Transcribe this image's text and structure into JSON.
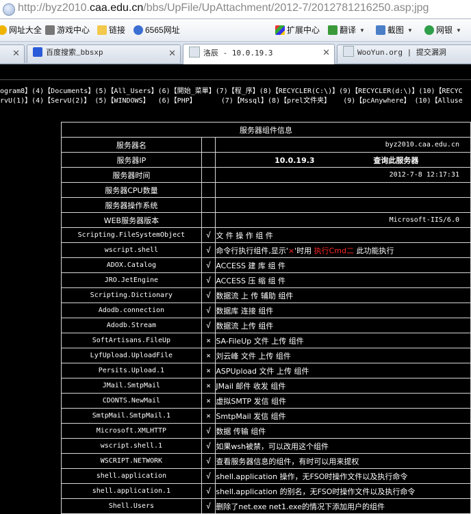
{
  "address_bar": {
    "url_prefix": "http://byz2010.",
    "url_domain": "caa.edu.cn",
    "url_path": "/bbs/UpFile/UpAttachment/2012-7/2012781216250.asp;jpg"
  },
  "toolbar": {
    "left": [
      "网址大全",
      "游戏中心",
      "链接",
      "6565网址"
    ],
    "right": [
      "扩展中心",
      "翻译",
      "截图",
      "网银"
    ]
  },
  "tabs": [
    {
      "label": "百度搜索_bbsxp"
    },
    {
      "label": "洛辰 - 10.0.19.3"
    },
    {
      "label": "WooYun.org | 提交漏洞"
    }
  ],
  "links": {
    "line1": "ogram8】(4)【Documents】(5)【All_Users】(6)【開始_菜單】(7)【程_序】(8)【RECYCLER(C:\\)】(9)【RECYCLER(d:\\)】(10)【RECYC",
    "line2": "rvU(1)】(4)【ServU(2)】 (5)【WINDOWS】  (6)【PHP】      (7)【Mssql】(8)【prel文件夹】   (9)【pcAnywhere】 (10)【Alluse"
  },
  "table": {
    "title": "服务器组件信息",
    "server_rows": [
      {
        "name": "服务器名",
        "value": "byz2010.caa.edu.cn"
      },
      {
        "name": "服务器IP",
        "value": "10.0.19.3",
        "extra": "查询此服务器"
      },
      {
        "name": "服务器时间",
        "value": "2012-7-8 12:17:31"
      },
      {
        "name": "服务器CPU数量",
        "value": ""
      },
      {
        "name": "服务器操作系统",
        "value": ""
      },
      {
        "name": "WEB服务器版本",
        "value": "Microsoft-IIS/6.0"
      }
    ],
    "components": [
      {
        "name": "Scripting.FileSystemObject",
        "mark": "√",
        "desc": "文 件 操 作 组 件"
      },
      {
        "name": "wscript.shell",
        "mark": "√",
        "desc_a": "命令行执行组件,显示'",
        "desc_x": "×",
        "desc_b": "'时用 ",
        "desc_red": "执行Cmd二",
        "desc_c": " 此功能执行"
      },
      {
        "name": "ADOX.Catalog",
        "mark": "√",
        "desc": "ACCESS 建 库 组 件"
      },
      {
        "name": "JRO.JetEngine",
        "mark": "√",
        "desc": "ACCESS 压 缩 组 件"
      },
      {
        "name": "Scripting.Dictionary",
        "mark": "√",
        "desc": "数据流 上 传 辅助 组件"
      },
      {
        "name": "Adodb.connection",
        "mark": "√",
        "desc": "数据库 连接 组件"
      },
      {
        "name": "Adodb.Stream",
        "mark": "√",
        "desc": "数据流 上传 组件"
      },
      {
        "name": "SoftArtisans.FileUp",
        "mark": "×",
        "desc": "SA-FileUp 文件 上传 组件"
      },
      {
        "name": "LyfUpload.UploadFile",
        "mark": "×",
        "desc": "刘云峰 文件 上传 组件"
      },
      {
        "name": "Persits.Upload.1",
        "mark": "×",
        "desc": "ASPUpload 文件 上传 组件"
      },
      {
        "name": "JMail.SmtpMail",
        "mark": "×",
        "desc": "JMail 邮件 收发 组件"
      },
      {
        "name": "CDONTS.NewMail",
        "mark": "×",
        "desc": "虚拟SMTP 发信 组件"
      },
      {
        "name": "SmtpMail.SmtpMail.1",
        "mark": "×",
        "desc": "SmtpMail 发信 组件"
      },
      {
        "name": "Microsoft.XMLHTTP",
        "mark": "√",
        "desc": "数据 传输 组件"
      },
      {
        "name": "wscript.shell.1",
        "mark": "√",
        "desc": "如果wsh被禁，可以改用这个组件"
      },
      {
        "name": "WSCRIPT.NETWORK",
        "mark": "√",
        "desc": "查看服务器信息的组件，有时可以用来提权"
      },
      {
        "name": "shell.application",
        "mark": "√",
        "desc": "shell.application 操作，无FSO时操作文件以及执行命令"
      },
      {
        "name": "shell.application.1",
        "mark": "√",
        "desc": "shell.application 的别名，无FSO时操作文件以及执行命令"
      },
      {
        "name": "Shell.Users",
        "mark": "√",
        "desc": "删除了net.exe net1.exe的情况下添加用户的组件"
      }
    ]
  },
  "colors": {
    "background": "#000000",
    "text": "#ffffff",
    "highlight_red": "#ff2828",
    "cell_border": "#d8d8d8"
  }
}
